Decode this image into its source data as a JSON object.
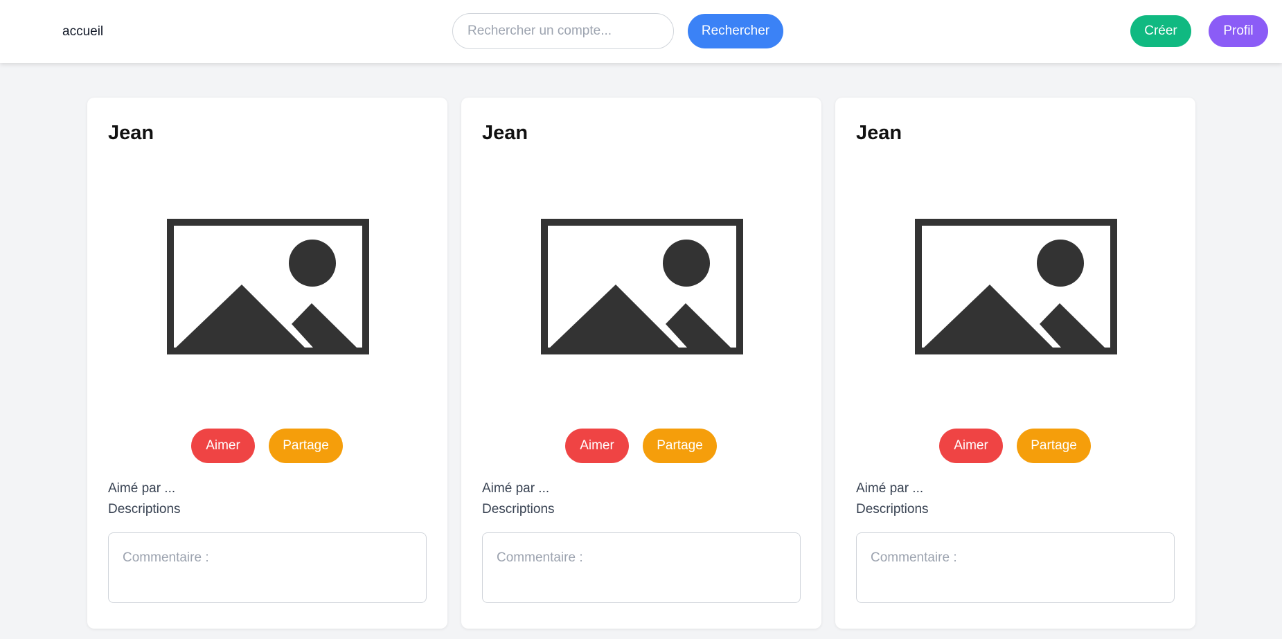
{
  "nav": {
    "home_label": "accueil",
    "search_placeholder": "Rechercher un compte...",
    "search_button": "Rechercher",
    "create_button": "Créer",
    "profile_button": "Profil"
  },
  "posts": [
    {
      "author": "Jean",
      "like_button": "Aimer",
      "share_button": "Partage",
      "liked_by": "Aimé par ...",
      "description": "Descriptions",
      "comment_placeholder": "Commentaire :"
    },
    {
      "author": "Jean",
      "like_button": "Aimer",
      "share_button": "Partage",
      "liked_by": "Aimé par ...",
      "description": "Descriptions",
      "comment_placeholder": "Commentaire :"
    },
    {
      "author": "Jean",
      "like_button": "Aimer",
      "share_button": "Partage",
      "liked_by": "Aimé par ...",
      "description": "Descriptions",
      "comment_placeholder": "Commentaire :"
    }
  ],
  "colors": {
    "search": "#3b82f6",
    "create": "#10b981",
    "profile": "#8b5cf6",
    "like": "#ef4444",
    "share": "#f59e0b",
    "image_icon": "#333333",
    "page_background": "#f3f4f6"
  },
  "icons": {
    "post_image": "image-placeholder-icon"
  }
}
